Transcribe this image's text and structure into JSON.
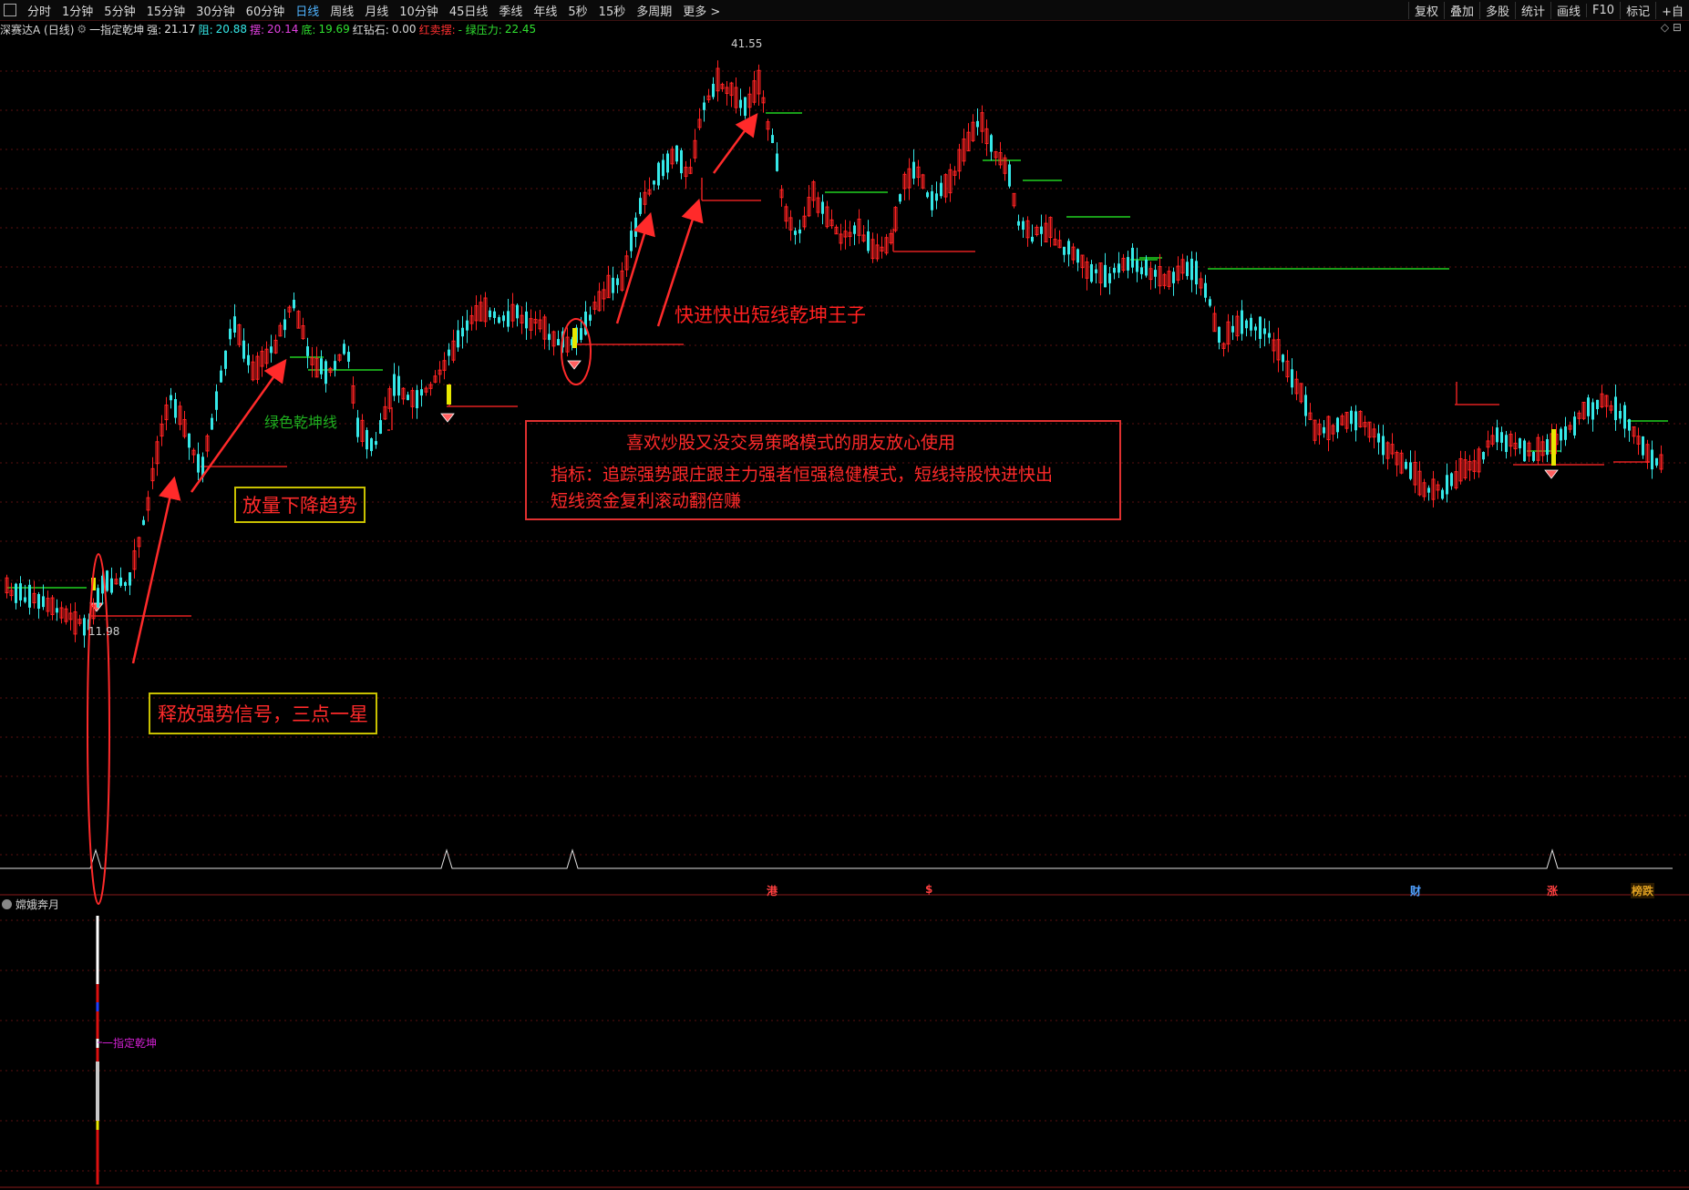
{
  "menu": {
    "items": [
      "分时",
      "1分钟",
      "5分钟",
      "15分钟",
      "30分钟",
      "60分钟",
      "日线",
      "周线",
      "月线",
      "10分钟",
      "45日线",
      "季线",
      "年线",
      "5秒",
      "15秒",
      "多周期",
      "更多 >"
    ],
    "active": "日线",
    "right": [
      "复权",
      "叠加",
      "多股",
      "统计",
      "画线",
      "F10",
      "标记",
      "+自"
    ]
  },
  "info": {
    "stock": "深赛达A (日线)",
    "indicator": "一指定乾坤",
    "qiang_label": "强:",
    "qiang_val": "21.17",
    "zu_label": "阻:",
    "zu_val": "20.88",
    "bai_label": "摆:",
    "bai_val": "20.14",
    "di_label": "底:",
    "di_val": "19.69",
    "hzs_label": "红钻石:",
    "hzs_val": "0.00",
    "hmb": "红卖摆:",
    "lyl_label": "- 绿压力:",
    "lyl_val": "22.45",
    "corner": "◇ ⊟"
  },
  "prices": {
    "high": "41.55",
    "low": "11.98"
  },
  "annotations": {
    "fastin": "快进快出短线乾坤王子",
    "greenline": "绿色乾坤线",
    "volume_down": "放量下降趋势",
    "release": "释放强势信号，三点一星",
    "box_line1": "喜欢炒股又没交易策略模式的朋友放心使用",
    "box_line2": "指标：追踪强势跟庄跟主力强者恒强稳健模式，短线持股快进快出",
    "box_line3": "短线资金复利滚动翻倍赚"
  },
  "markers": [
    "港",
    "$",
    "财",
    "涨",
    "榜跌"
  ],
  "subchart": {
    "title": "嫦娥奔月",
    "label": "一指定乾坤"
  },
  "colors": {
    "up": "#ff2222",
    "down": "#35e8e8",
    "green_line": "#20d020",
    "red_line": "#e02020",
    "yellow": "#e8e800"
  }
}
